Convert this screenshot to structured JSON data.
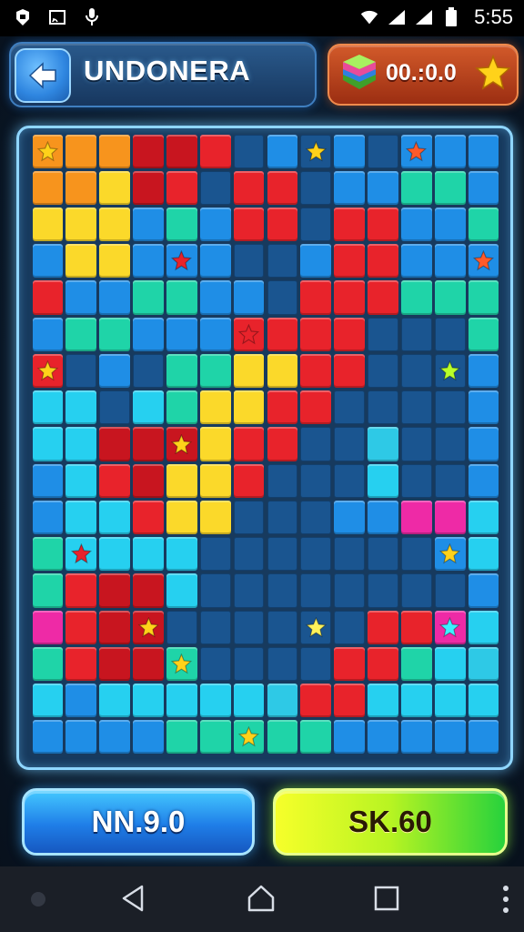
{
  "status_bar": {
    "time": "5:55",
    "left_icons": [
      "app-icon",
      "cast-icon",
      "mic-icon"
    ],
    "right_icons": [
      "wifi-icon",
      "signal-icon",
      "signal-icon",
      "battery-icon"
    ]
  },
  "header": {
    "title": "UNDONERA",
    "timer": "00.:0.0",
    "back_icon": "arrow-left-icon",
    "gem_icon": "gem-stack-icon",
    "star_icon": "star-icon"
  },
  "board": {
    "cols": 14,
    "rows": 19,
    "palette": {
      "o": "#f7941d",
      "r": "#e8232b",
      "d": "#c8151f",
      "y": "#fbd92a",
      "Y": "#ffe93a",
      "c": "#26d0f0",
      "t": "#1fd4a8",
      "b": "#1f8ee6",
      "n": "#1a5590",
      "m": "#2b6db0",
      "p": "#ee2aa6",
      "g": "#2ee8a0",
      "a": "#2ec9e6"
    },
    "grid": [
      "oooddrnbnbnbbb",
      "ooydrnrrnbbttb",
      "yyybtbrrnrrbbt",
      "byybbbnnbrrbbb",
      "rbbttbbnrrrttt",
      "bttbbbrrrrnnnt",
      "rnbnttyyrrnnnb",
      "ccnctyyrrnnnnb",
      "ccdddyrrnnannb",
      "bcrdyyrnnncnnb",
      "bccryynnnbbppc",
      "tccccnnnnnnnbc",
      "trddcnnnnnnnnb",
      "prddnnnnnnrrpc",
      "trddtnnnnrrtca",
      "cbcccccarrcccc",
      "bbbbtttttbbbbb"
    ],
    "stars": [
      {
        "cell": [
          0,
          0
        ],
        "color": "#ffd21a"
      },
      {
        "cell": [
          0,
          8
        ],
        "color": "#ffd21a"
      },
      {
        "cell": [
          0,
          11
        ],
        "color": "#ff5a2a"
      },
      {
        "cell": [
          3,
          4
        ],
        "color": "#e8232b"
      },
      {
        "cell": [
          3,
          13
        ],
        "color": "#ff5a2a"
      },
      {
        "cell": [
          5,
          6
        ],
        "color": "#e8232b"
      },
      {
        "cell": [
          6,
          0
        ],
        "color": "#ffd21a"
      },
      {
        "cell": [
          6,
          12
        ],
        "color": "#b8ff2a"
      },
      {
        "cell": [
          8,
          4
        ],
        "color": "#ffd21a"
      },
      {
        "cell": [
          11,
          1
        ],
        "color": "#e8232b"
      },
      {
        "cell": [
          11,
          12
        ],
        "color": "#ffd21a"
      },
      {
        "cell": [
          13,
          8
        ],
        "color": "#fff35a"
      },
      {
        "cell": [
          13,
          12
        ],
        "color": "#3ef0ff"
      },
      {
        "cell": [
          13,
          3
        ],
        "color": "#ffd21a"
      },
      {
        "cell": [
          14,
          4
        ],
        "color": "#ffd21a"
      },
      {
        "cell": [
          16,
          6
        ],
        "color": "#ffd21a"
      },
      {
        "cell": [
          17,
          1
        ],
        "color": "#ff5a2a"
      },
      {
        "cell": [
          17,
          4
        ],
        "color": "#ff5a2a"
      },
      {
        "cell": [
          17,
          11
        ],
        "color": "#ff5a2a"
      },
      {
        "cell": [
          17,
          13
        ],
        "color": "#ff5a2a"
      }
    ]
  },
  "buttons": {
    "left_label": "NN.9.0",
    "right_label": "SK.60"
  },
  "nav": {
    "icons": [
      "nav-back-icon",
      "nav-home-icon",
      "nav-recent-icon",
      "overflow-icon"
    ]
  }
}
